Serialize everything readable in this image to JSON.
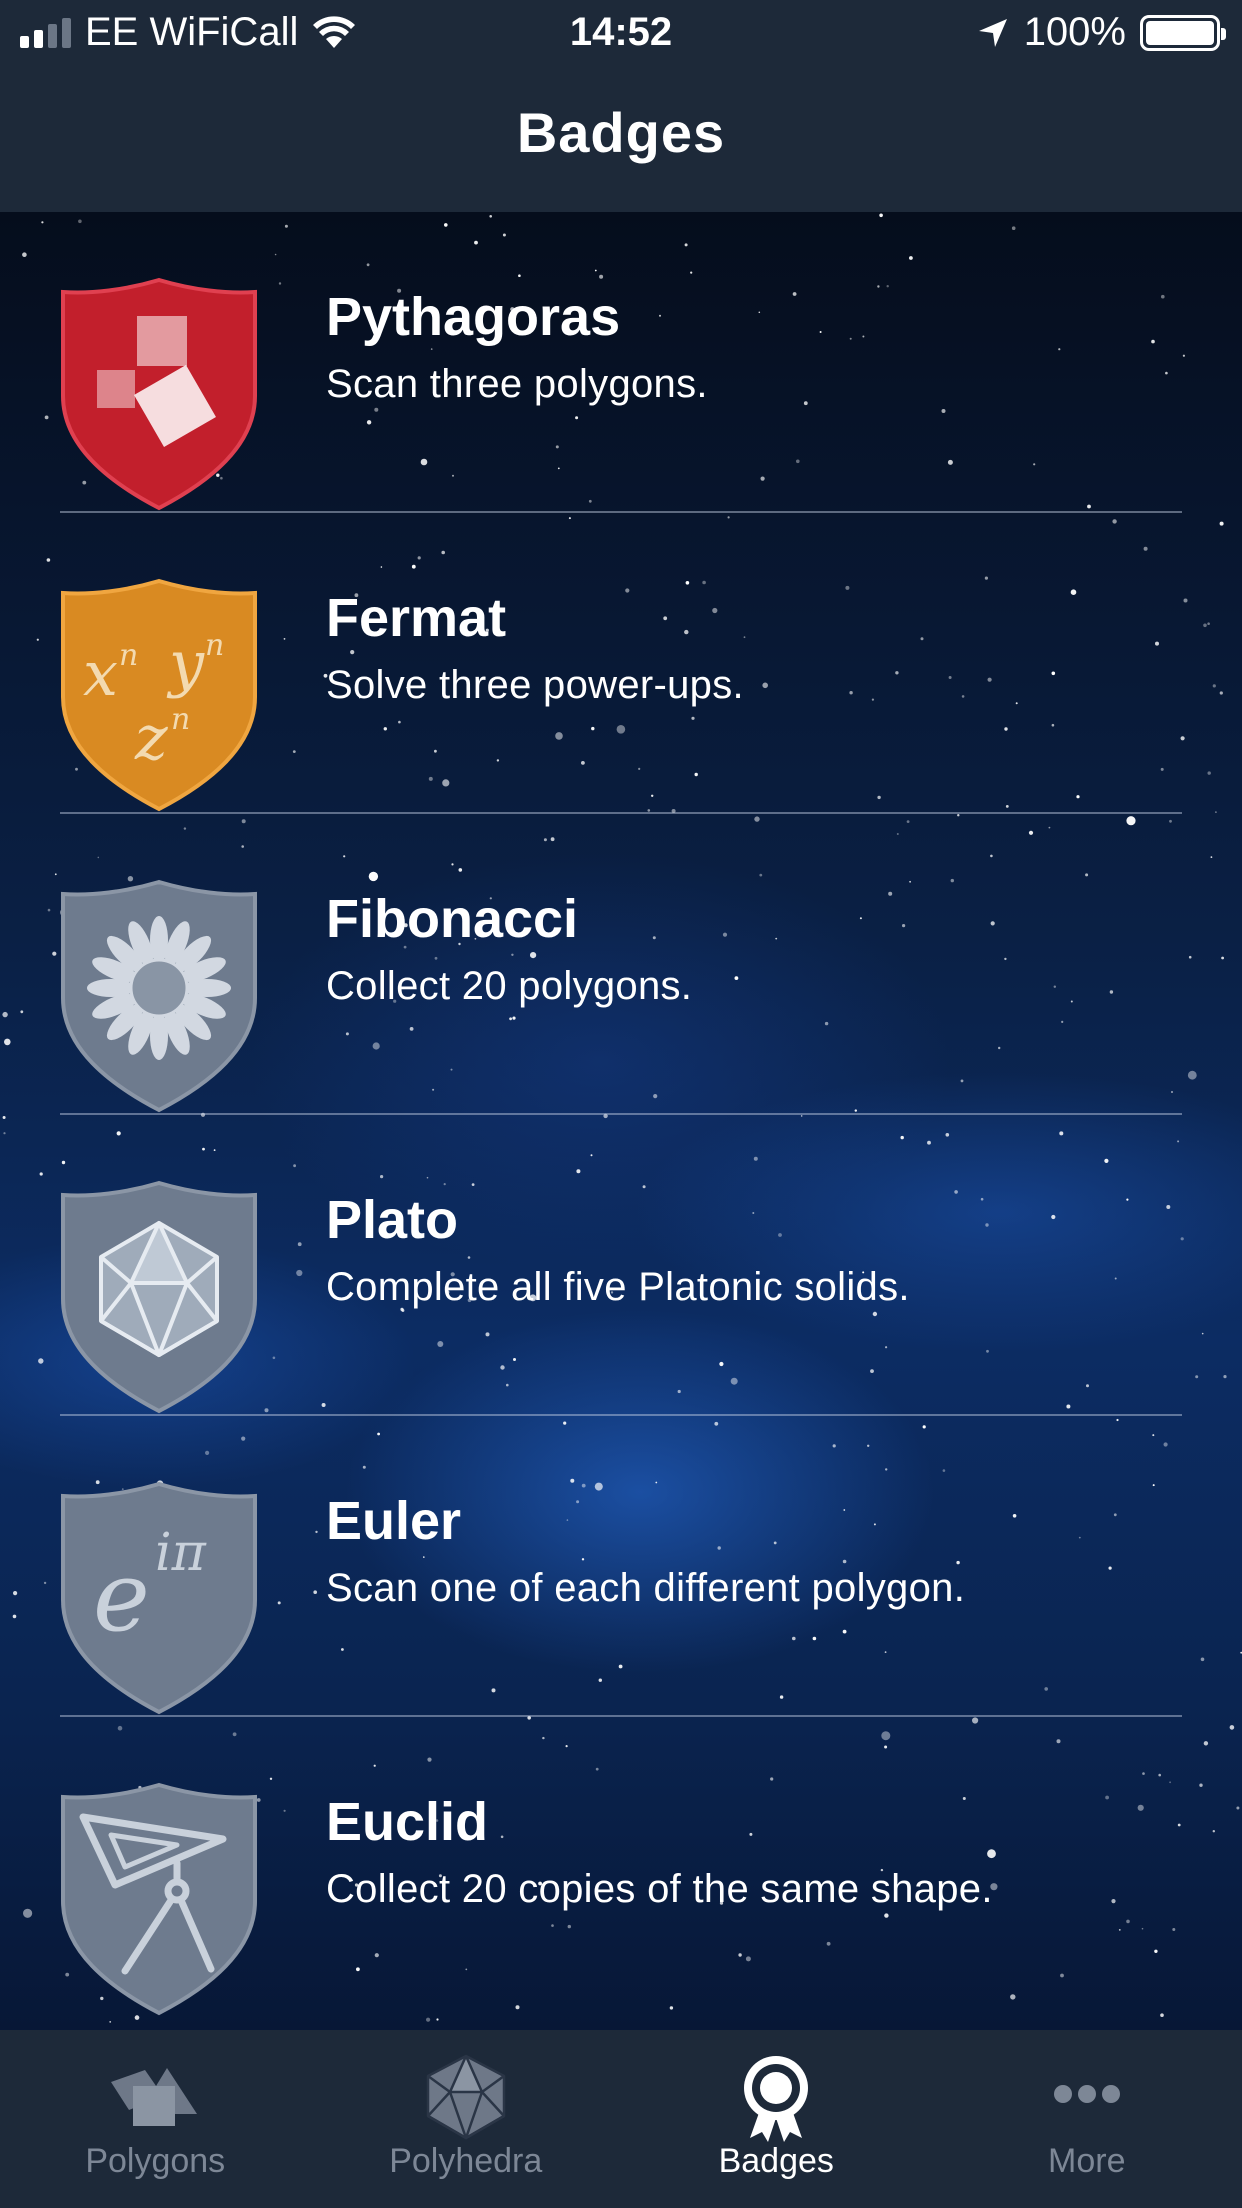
{
  "status_bar": {
    "carrier": "EE WiFiCall",
    "time": "14:52",
    "battery": "100%"
  },
  "nav": {
    "title": "Badges"
  },
  "badges": [
    {
      "title": "Pythagoras",
      "description": "Scan three polygons.",
      "shield_color": "#c21f2c",
      "icon": "squares-icon"
    },
    {
      "title": "Fermat",
      "description": "Solve three power-ups.",
      "shield_color": "#d98a22",
      "icon": "powers-icon",
      "icon_text": [
        "xn",
        "yn",
        "zn"
      ]
    },
    {
      "title": "Fibonacci",
      "description": "Collect 20 polygons.",
      "shield_color": "#6e7b8e",
      "icon": "sunflower-icon"
    },
    {
      "title": "Plato",
      "description": "Complete all five Platonic solids.",
      "shield_color": "#6e7b8e",
      "icon": "icosahedron-icon"
    },
    {
      "title": "Euler",
      "description": "Scan one of each different polygon.",
      "shield_color": "#6e7b8e",
      "icon": "euler-identity-icon",
      "icon_text": "eiπ"
    },
    {
      "title": "Euclid",
      "description": "Collect 20 copies of the same shape.",
      "shield_color": "#6e7b8e",
      "icon": "set-square-compass-icon"
    }
  ],
  "tabs": [
    {
      "label": "Polygons",
      "icon": "polygons-icon",
      "active": false
    },
    {
      "label": "Polyhedra",
      "icon": "polyhedra-icon",
      "active": false
    },
    {
      "label": "Badges",
      "icon": "badge-icon",
      "active": true
    },
    {
      "label": "More",
      "icon": "more-icon",
      "active": false
    }
  ],
  "colors": {
    "bar_background": "#1d2939",
    "tab_inactive": "#7d8796",
    "tab_active": "#ffffff",
    "locked_shield": "#6e7b8e"
  }
}
